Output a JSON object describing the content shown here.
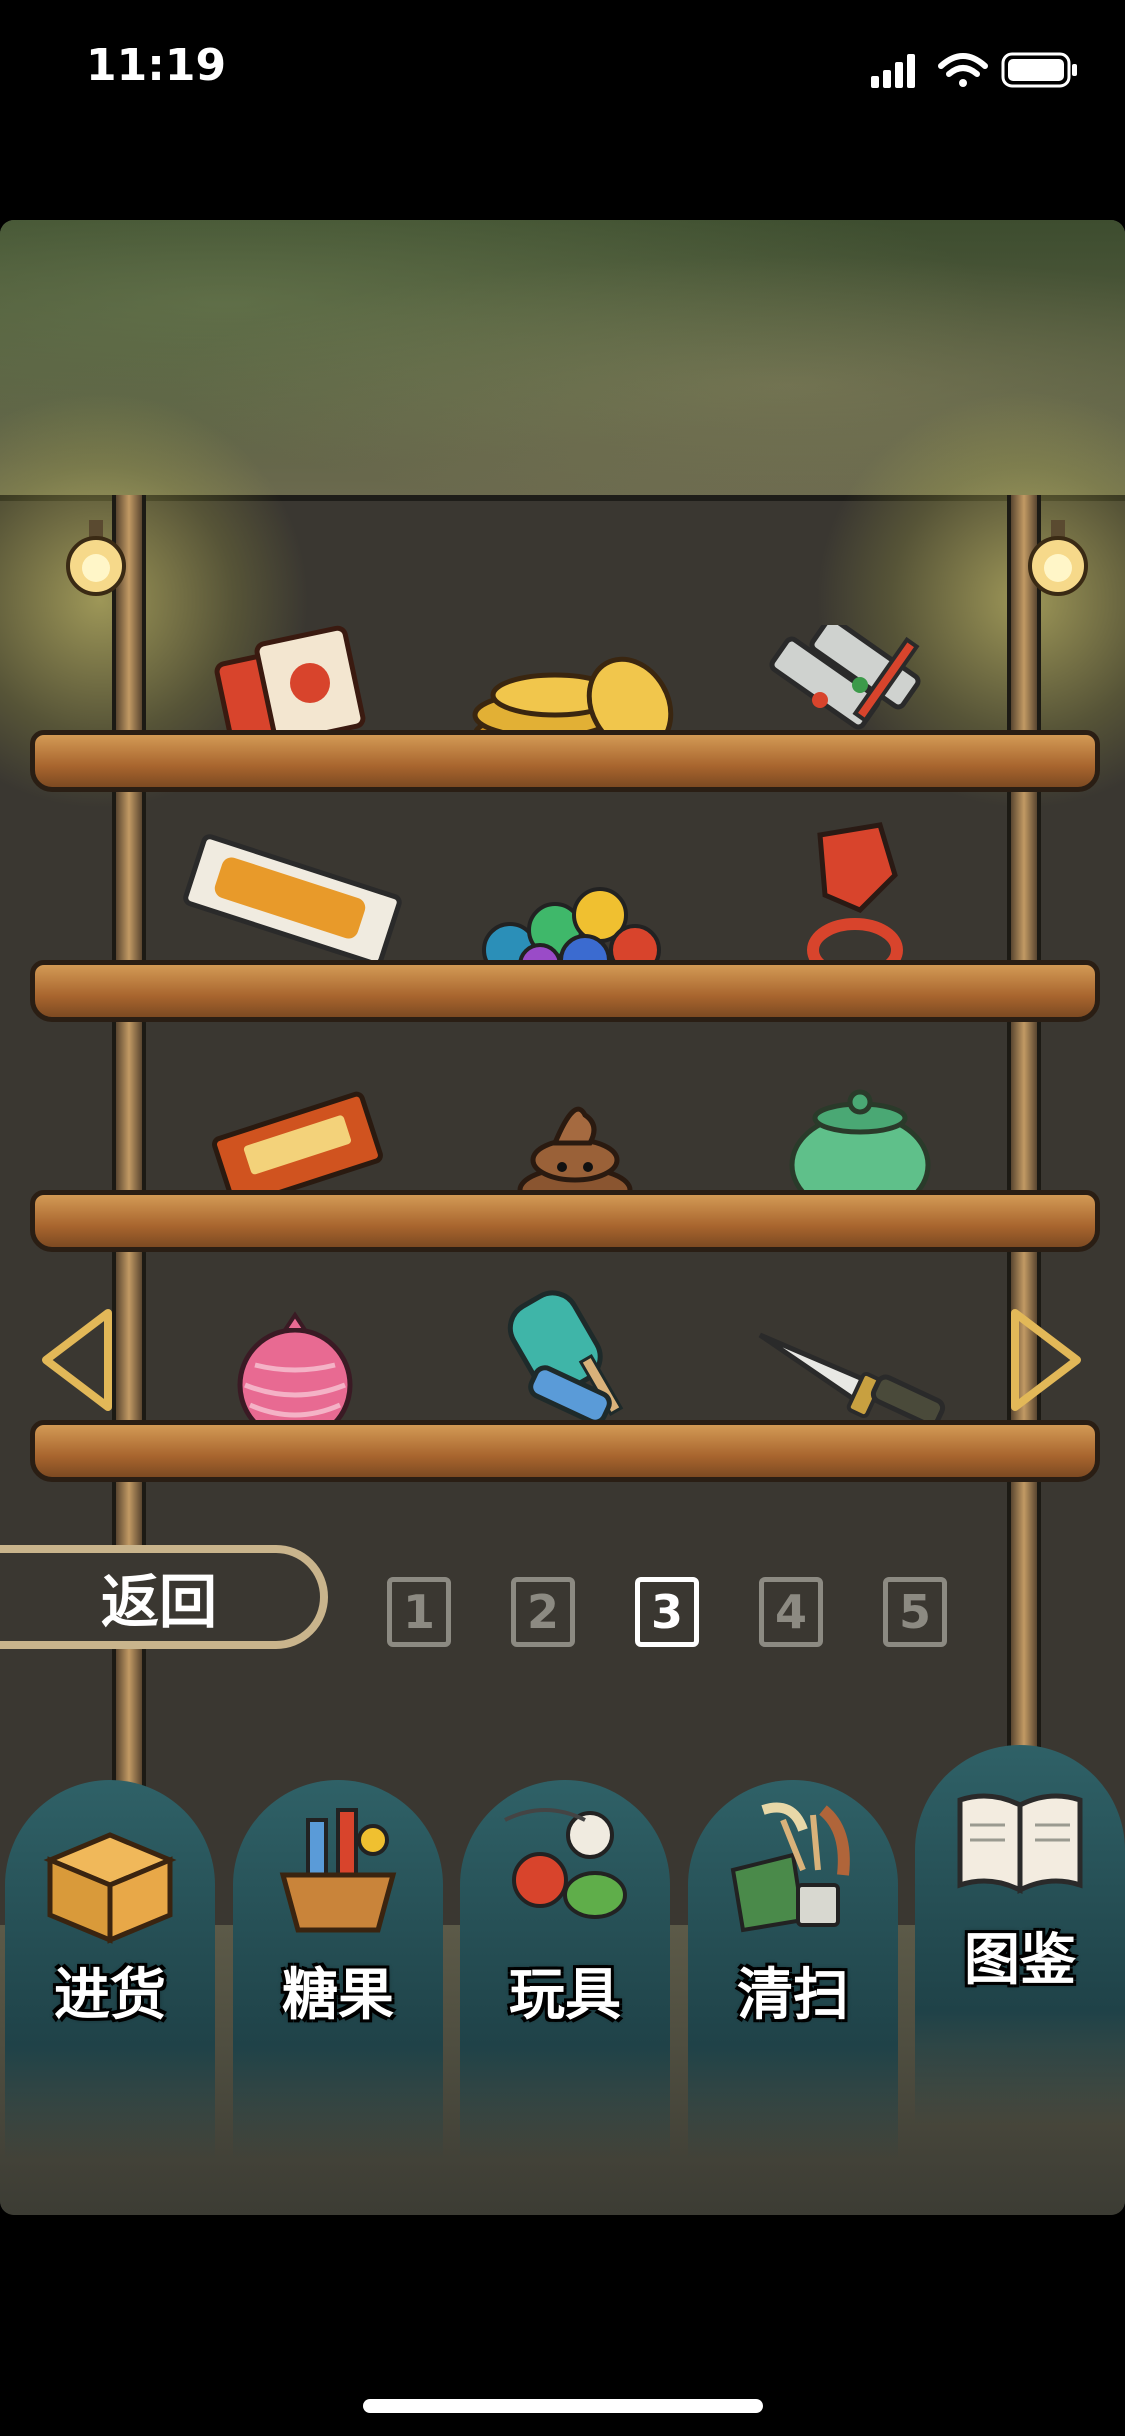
{
  "status_bar": {
    "time": "11:19",
    "icons": [
      "cellular-icon",
      "wifi-icon",
      "battery-icon"
    ]
  },
  "shelves": [
    {
      "items": [
        "card-pack-icon",
        "gold-coins-icon",
        "paint-tubes-icon"
      ]
    },
    {
      "items": [
        "snack-bar-icon",
        "gumballs-icon",
        "ring-pop-icon"
      ]
    },
    {
      "items": [
        "kabayaki-snack-icon",
        "poop-toy-icon",
        "green-jar-icon"
      ]
    },
    {
      "items": [
        "water-balloon-icon",
        "popsicle-icon",
        "toy-knife-icon"
      ]
    }
  ],
  "back_button": {
    "label": "返回"
  },
  "pages": [
    {
      "label": "1",
      "active": false
    },
    {
      "label": "2",
      "active": false
    },
    {
      "label": "3",
      "active": true
    },
    {
      "label": "4",
      "active": false
    },
    {
      "label": "5",
      "active": false
    }
  ],
  "nav": {
    "restock": {
      "label": "进货",
      "icon": "box-icon"
    },
    "candy": {
      "label": "糖果",
      "icon": "candy-basket-icon"
    },
    "toys": {
      "label": "玩具",
      "icon": "toys-icon"
    },
    "clean": {
      "label": "清扫",
      "icon": "cleaning-icon"
    },
    "catalog": {
      "label": "图鉴",
      "icon": "book-icon"
    }
  },
  "colors": {
    "accent_gold": "#e2b858",
    "page_active": "#ffffff",
    "page_inactive": "#8c8a82"
  }
}
